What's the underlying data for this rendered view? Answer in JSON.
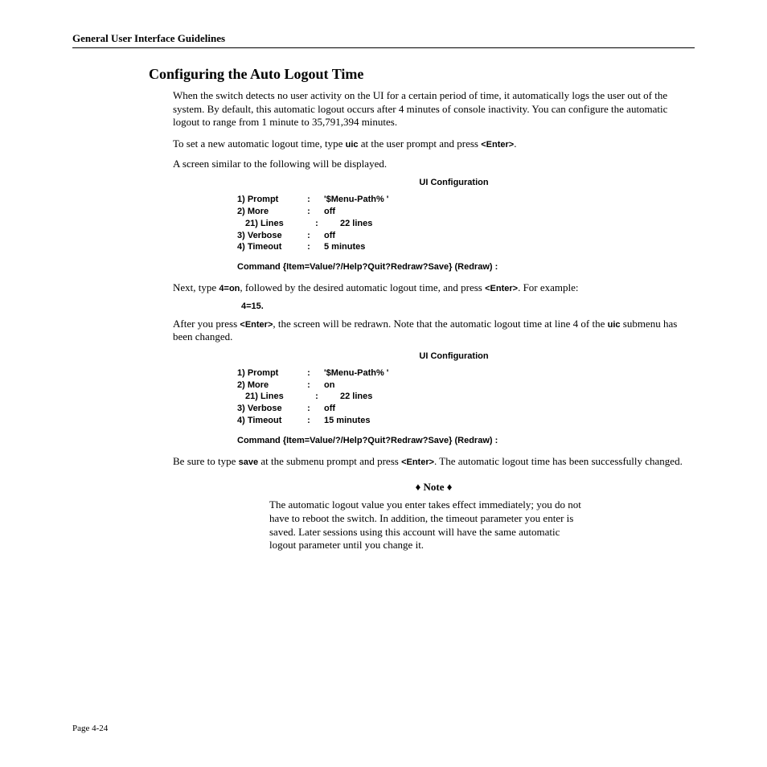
{
  "runningHead": "General User Interface Guidelines",
  "sectionHeading": "Configuring the Auto Logout Time",
  "para1a": "When the switch detects no user activity on the ",
  "para1b": "UI",
  "para1c": " for a certain period of time, it automatically logs the user out of the system. By default, this automatic logout occurs after 4 minutes of console inactivity. You can configure the automatic logout to range from 1 minute to 35,791,394 minutes.",
  "para2a": "To set a new automatic logout time, type ",
  "para2b": "uic",
  "para2c": " at the user prompt and press ",
  "para2d": "<Enter>",
  "para2e": ".",
  "para3": "A screen similar to the following will be displayed.",
  "configTitle": "UI Configuration",
  "cfg1": {
    "r1l": "1)  Prompt",
    "r1v": "'$Menu-Path% '",
    "r2l": "2)  More",
    "r2v": "off",
    "r3l": "21) Lines",
    "r3v": "22 lines",
    "r4l": "3)  Verbose",
    "r4v": "off",
    "r5l": "4)  Timeout",
    "r5v": "5 minutes"
  },
  "commandLine": "Command {Item=Value/?/Help?Quit?Redraw?Save} (Redraw)    :",
  "para4a": "Next, type ",
  "para4b": "4=on",
  "para4c": ", followed by the desired automatic logout time, and press ",
  "para4d": "<Enter>",
  "para4e": ". For example:",
  "example": "4=15.",
  "para5a": "After you press ",
  "para5b": "<Enter>",
  "para5c": ", the screen will be redrawn. Note that the automatic logout time at line 4 of the ",
  "para5d": "uic",
  "para5e": " submenu has been changed.",
  "cfg2": {
    "r1l": "1)  Prompt",
    "r1v": "'$Menu-Path% '",
    "r2l": "2)  More",
    "r2v": "on",
    "r3l": "21) Lines",
    "r3v": "22 lines",
    "r4l": "3)  Verbose",
    "r4v": "off",
    "r5l": "4)  Timeout",
    "r5v": "15 minutes"
  },
  "para6a": "Be sure to type ",
  "para6b": "save",
  "para6c": " at the submenu prompt and press ",
  "para6d": "<Enter>",
  "para6e": ". The automatic logout time has been successfully changed.",
  "noteTitle": "♦ Note ♦",
  "noteBody": "The automatic logout value you enter takes effect immediately; you do not have to reboot the switch. In addition, the timeout parameter you enter is saved. Later sessions using this account will have the same automatic logout parameter until you change it.",
  "pageNum": "Page 4-24"
}
